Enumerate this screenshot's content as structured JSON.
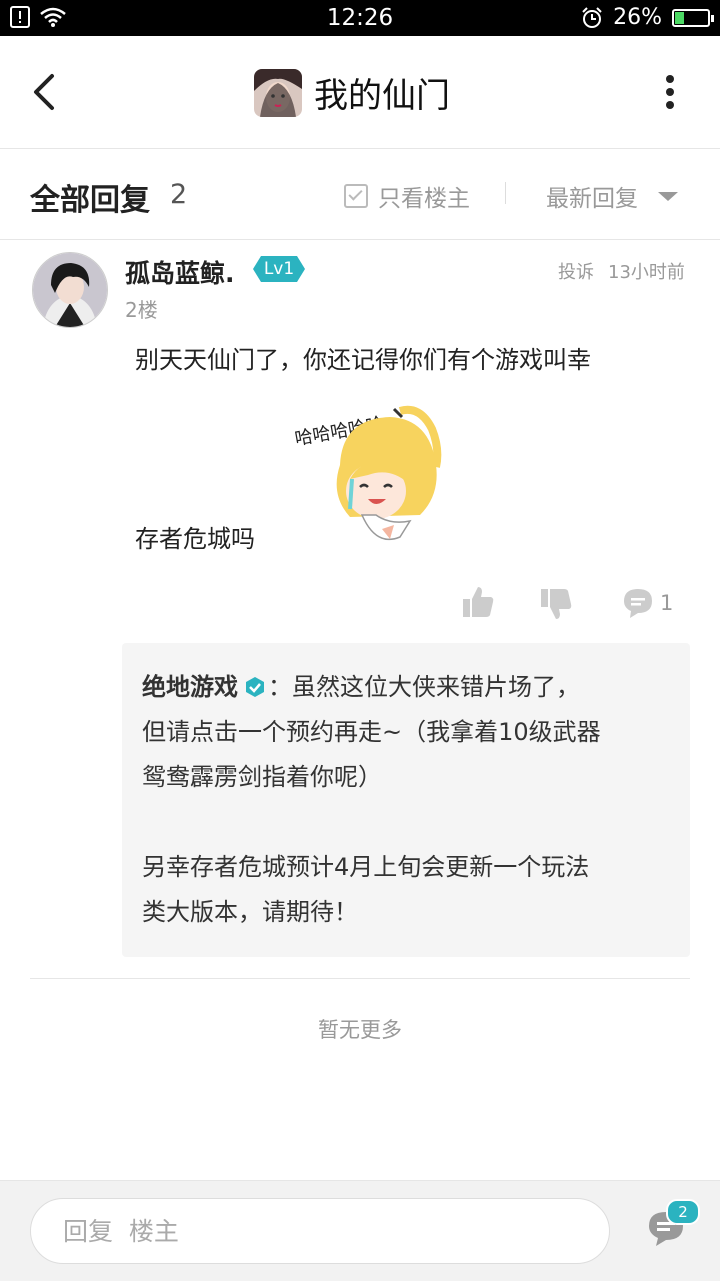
{
  "status_bar": {
    "time": "12:26",
    "battery_percent": "26%",
    "battery_level": 0.26,
    "icons": [
      "sim-alert-icon",
      "wifi-icon",
      "alarm-icon",
      "battery-icon"
    ]
  },
  "header": {
    "title": "我的仙门",
    "back_icon": "back-arrow-icon",
    "more_icon": "more-vertical-icon"
  },
  "subheader": {
    "all_replies_label": "全部回复",
    "reply_count": "2",
    "only_op_label": "只看楼主",
    "sort_label": "最新回复"
  },
  "reply": {
    "username": "孤岛蓝鲸.",
    "level": "Lv1",
    "report_label": "投诉",
    "time_ago": "13小时前",
    "floor": "2楼",
    "content_line1": "别天天仙门了，你还记得你们有个游戏叫幸",
    "content_line2": "存者危城吗",
    "sticker_text": "哈哈哈哈哈...",
    "comment_count": "1",
    "sub_reply": {
      "author": "绝地游戏",
      "line1": "：虽然这位大侠来错片场了，",
      "line2": "但请点击一个预约再走~（我拿着10级武器",
      "line3": "鸳鸯霹雳剑指着你呢）",
      "line4": "另幸存者危城预计4月上旬会更新一个玩法",
      "line5": "类大版本，请期待！"
    }
  },
  "no_more_label": "暂无更多",
  "bottom": {
    "reply_placeholder": "回复  楼主",
    "comments_badge": "2"
  },
  "colors": {
    "accent": "#2bb3c0",
    "text_primary": "#222222",
    "text_secondary": "#999999",
    "sub_reply_bg": "#f5f5f5"
  }
}
